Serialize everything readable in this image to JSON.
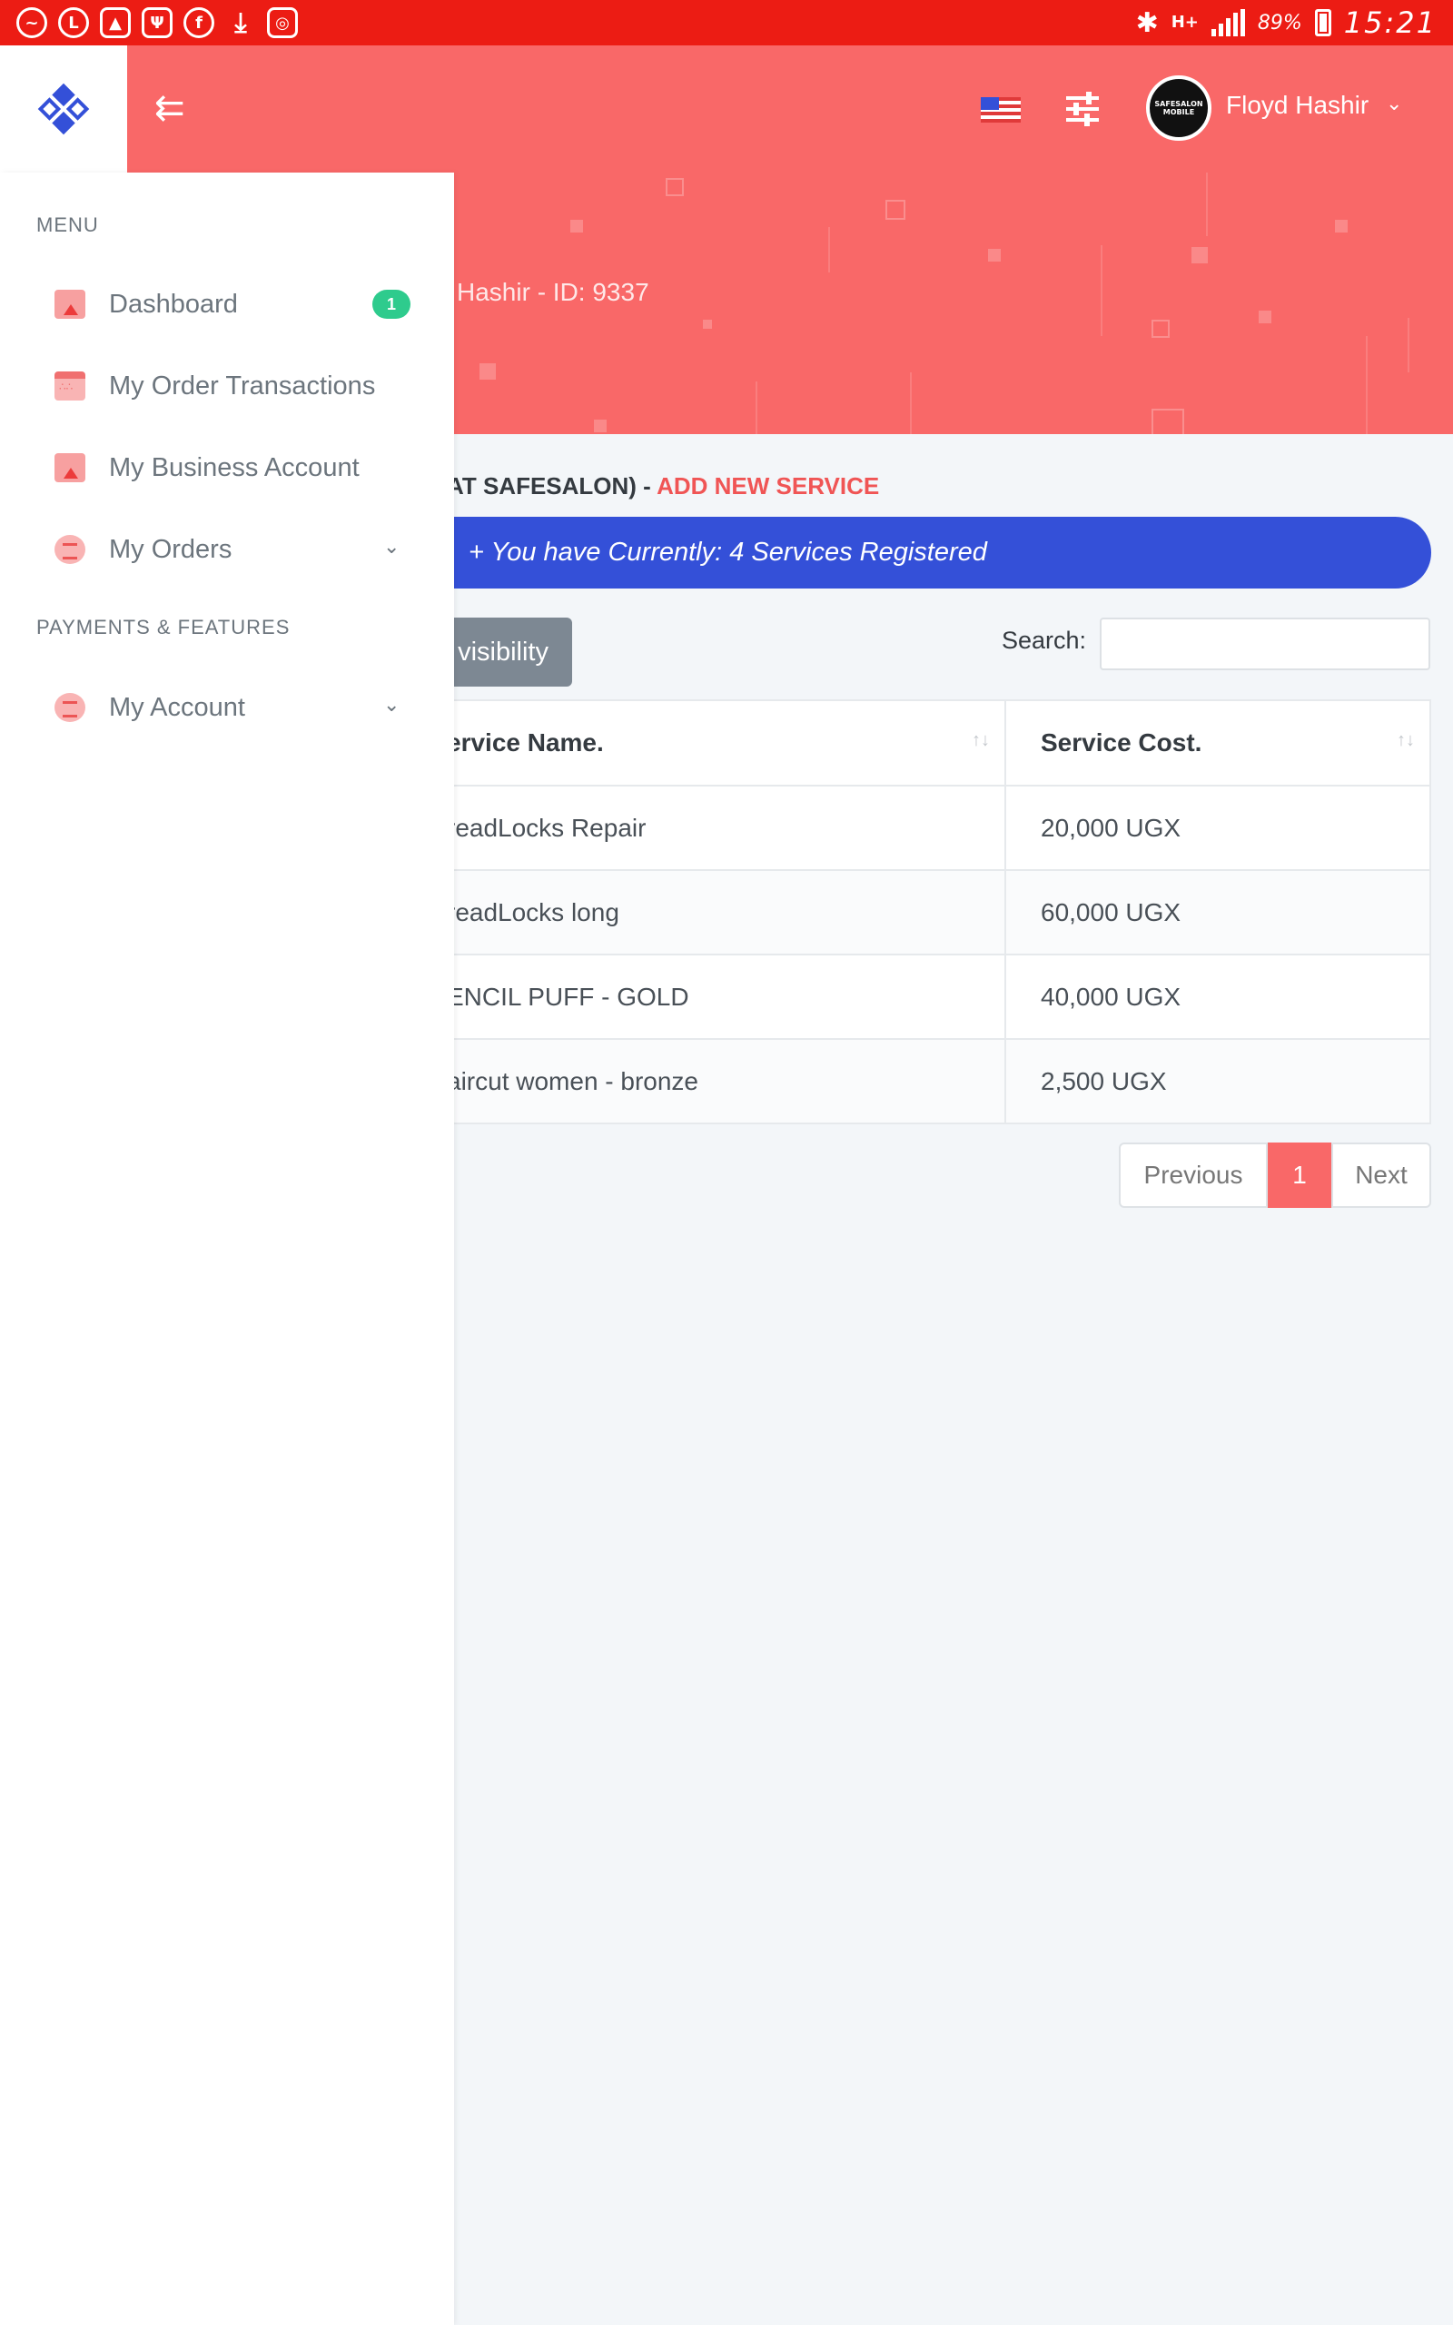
{
  "status_bar": {
    "left_icons": [
      "messenger-icon",
      "app-icon",
      "gallery-icon",
      "usb-icon",
      "facebook-icon",
      "download-icon",
      "instagram-icon"
    ],
    "network": "H+",
    "battery": "89%",
    "time": "15:21"
  },
  "header": {
    "user_name": "Floyd Hashir",
    "avatar_text": "SAFESALON MOBILE"
  },
  "hero": {
    "text": "Hashir - ID: 9337"
  },
  "content": {
    "heading_prefix": "AT SAFESALON) - ",
    "heading_link": "ADD NEW SERVICE",
    "banner_text": "+ You have Currently: 4 Services Registered",
    "visibility_button": "visibility",
    "search_label": "Search:",
    "search_value": ""
  },
  "table": {
    "columns": [
      "ervice Name.",
      "Service Cost."
    ],
    "rows": [
      [
        "readLocks Repair",
        "20,000 UGX"
      ],
      [
        "readLocks long",
        "60,000 UGX"
      ],
      [
        "ENCIL PUFF - GOLD",
        "40,000 UGX"
      ],
      [
        "aircut women - bronze",
        "2,500 UGX"
      ]
    ]
  },
  "pagination": {
    "previous": "Previous",
    "current": "1",
    "next": "Next"
  },
  "sidebar": {
    "menu_title": "MENU",
    "items": [
      {
        "label": "Dashboard",
        "badge": "1"
      },
      {
        "label": "My Order Transactions"
      },
      {
        "label": "My Business Account"
      },
      {
        "label": "My Orders"
      }
    ],
    "section2_title": "PAYMENTS & FEATURES",
    "items2": [
      {
        "label": "My Account"
      }
    ]
  },
  "colors": {
    "status_bar": "#ec1c14",
    "header": "#f96868",
    "primary": "#3450d8",
    "badge": "#2ecb8d",
    "accent_text": "#f05555"
  }
}
